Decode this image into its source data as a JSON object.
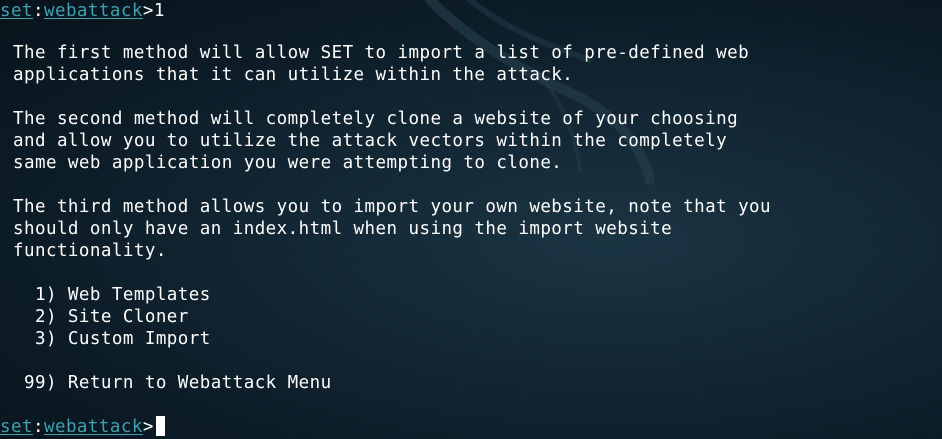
{
  "prompt": {
    "set": "set",
    "sep": ":",
    "module": "webattack",
    "arrow": ">"
  },
  "input": "1",
  "paragraphs": [
    [
      "The first method will allow SET to import a list of pre-defined web",
      "applications that it can utilize within the attack."
    ],
    [
      "The second method will completely clone a website of your choosing",
      "and allow you to utilize the attack vectors within the completely",
      "same web application you were attempting to clone."
    ],
    [
      "The third method allows you to import your own website, note that you",
      "should only have an index.html when using the import website",
      "functionality."
    ]
  ],
  "menu": [
    "  1) Web Templates",
    "  2) Site Cloner",
    "  3) Custom Import"
  ],
  "return_option": " 99) Return to Webattack Menu",
  "colors": {
    "prompt": "#3fa0b0",
    "text": "#ffffff",
    "background": "#122633"
  }
}
